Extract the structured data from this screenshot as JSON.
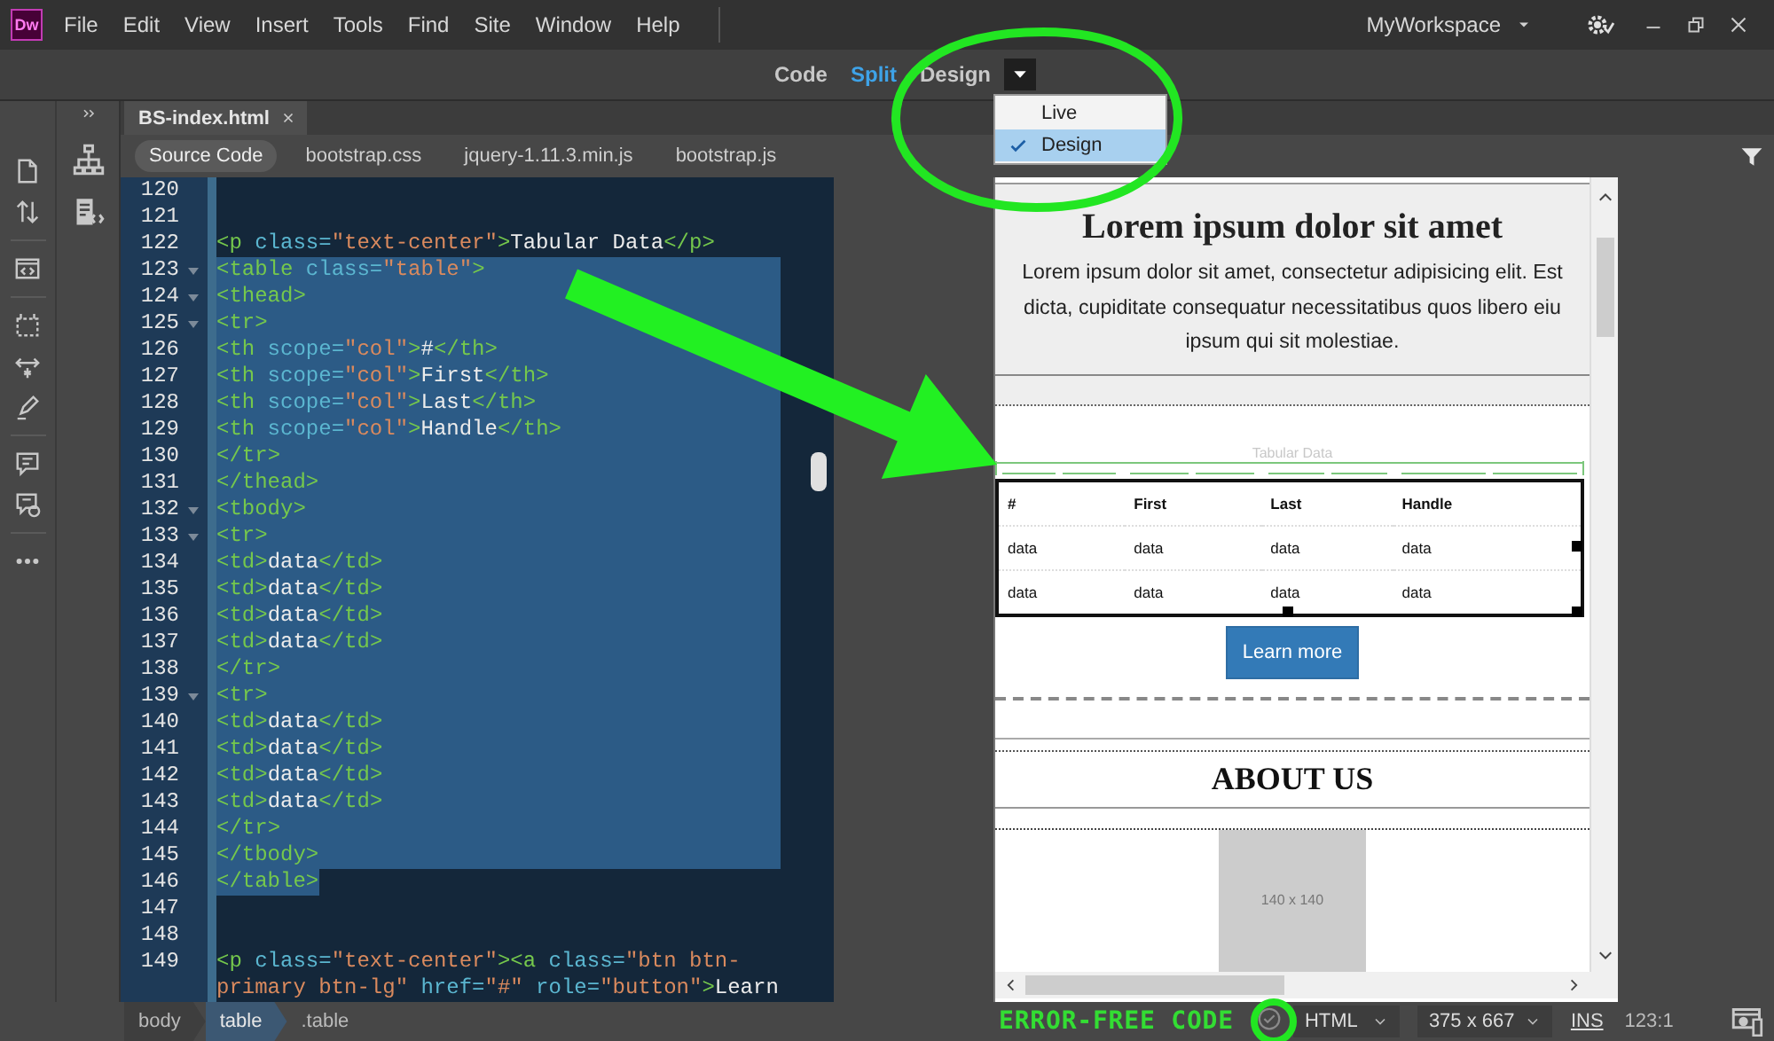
{
  "app": {
    "logo": "Dw"
  },
  "menu": [
    "File",
    "Edit",
    "View",
    "Insert",
    "Tools",
    "Find",
    "Site",
    "Window",
    "Help"
  ],
  "workspace": {
    "label": "MyWorkspace"
  },
  "view_switch": [
    {
      "label": "Code",
      "selected": false
    },
    {
      "label": "Split",
      "selected": true
    },
    {
      "label": "Design",
      "selected": false
    }
  ],
  "view_menu": [
    {
      "label": "Live",
      "checked": false,
      "selected": false
    },
    {
      "label": "Design",
      "checked": true,
      "selected": true
    }
  ],
  "document_tabs": [
    {
      "label": "BS-index.html",
      "selected": true
    }
  ],
  "related_files": [
    {
      "label": "Source Code",
      "selected": true
    },
    {
      "label": "bootstrap.css",
      "selected": false
    },
    {
      "label": "jquery-1.11.3.min.js",
      "selected": false
    },
    {
      "label": "bootstrap.js",
      "selected": false
    }
  ],
  "code_lines": [
    {
      "number": "120",
      "fold": false
    },
    {
      "number": "121",
      "fold": false
    },
    {
      "number": "122",
      "code": "<p class=\"text-center\">Tabular Data</p>",
      "fold": false,
      "selected": false
    },
    {
      "number": "123",
      "code": "<table class=\"table\">",
      "fold": true,
      "selected": true
    },
    {
      "number": "124",
      "code": "<thead>",
      "fold": true,
      "selected": true
    },
    {
      "number": "125",
      "code": "<tr>",
      "fold": true,
      "selected": true
    },
    {
      "number": "126",
      "code": "<th scope=\"col\">#</th>",
      "fold": false,
      "selected": true
    },
    {
      "number": "127",
      "code": "<th scope=\"col\">First</th>",
      "fold": false,
      "selected": true
    },
    {
      "number": "128",
      "code": "<th scope=\"col\">Last</th>",
      "fold": false,
      "selected": true
    },
    {
      "number": "129",
      "code": "<th scope=\"col\">Handle</th>",
      "fold": false,
      "selected": true
    },
    {
      "number": "130",
      "code": "</tr>",
      "fold": false,
      "selected": true
    },
    {
      "number": "131",
      "code": "</thead>",
      "fold": false,
      "selected": true
    },
    {
      "number": "132",
      "code": "<tbody>",
      "fold": true,
      "selected": true
    },
    {
      "number": "133",
      "code": "<tr>",
      "fold": true,
      "selected": true
    },
    {
      "number": "134",
      "code": "<td>data</td>",
      "fold": false,
      "selected": true
    },
    {
      "number": "135",
      "code": "<td>data</td>",
      "fold": false,
      "selected": true
    },
    {
      "number": "136",
      "code": "<td>data</td>",
      "fold": false,
      "selected": true
    },
    {
      "number": "137",
      "code": "<td>data</td>",
      "fold": false,
      "selected": true
    },
    {
      "number": "138",
      "code": "</tr>",
      "fold": false,
      "selected": true
    },
    {
      "number": "139",
      "code": "<tr>",
      "fold": true,
      "selected": true
    },
    {
      "number": "140",
      "code": "<td>data</td>",
      "fold": false,
      "selected": true
    },
    {
      "number": "141",
      "code": "<td>data</td>",
      "fold": false,
      "selected": true
    },
    {
      "number": "142",
      "code": "<td>data</td>",
      "fold": false,
      "selected": true
    },
    {
      "number": "143",
      "code": "<td>data</td>",
      "fold": false,
      "selected": true
    },
    {
      "number": "144",
      "code": "</tr>",
      "fold": false,
      "selected": true
    },
    {
      "number": "145",
      "code": "</tbody>",
      "fold": false,
      "selected": true
    },
    {
      "number": "146",
      "code": "</table>",
      "fold": false,
      "selected": true
    },
    {
      "number": "147",
      "fold": false
    },
    {
      "number": "148",
      "fold": false
    },
    {
      "number": "149",
      "code": "<p class=\"text-center\"><a class=\"btn btn-primary btn-lg\" href=\"#\" role=\"button\">Learn",
      "fold": false,
      "selected": false
    }
  ],
  "design_view": {
    "hero": {
      "heading": "Lorem ipsum dolor sit amet",
      "text": "Lorem ipsum dolor sit amet, consectetur adipisicing elit. Est\ndicta, cupiditate consequatur necessitatibus quos libero eiu\nipsum qui sit molestiae."
    },
    "table_caption": "Tabular Data",
    "table": {
      "columns": [
        "#",
        "First",
        "Last",
        "Handle"
      ],
      "rows": [
        [
          "data",
          "data",
          "data",
          "data"
        ],
        [
          "data",
          "data",
          "data",
          "data"
        ]
      ]
    },
    "button": "Learn more",
    "section_heading": "ABOUT US",
    "image_label": "140 x 140"
  },
  "status_bar": {
    "tag_path": [
      {
        "label": "body",
        "selected": false
      },
      {
        "label": "table",
        "selected": true
      },
      {
        "label": ".table",
        "selected": false
      }
    ],
    "annotation": "ERROR-FREE CODE",
    "language": "HTML",
    "viewport": "375 x 667",
    "insert_mode": "INS",
    "cursor": "123:1"
  }
}
